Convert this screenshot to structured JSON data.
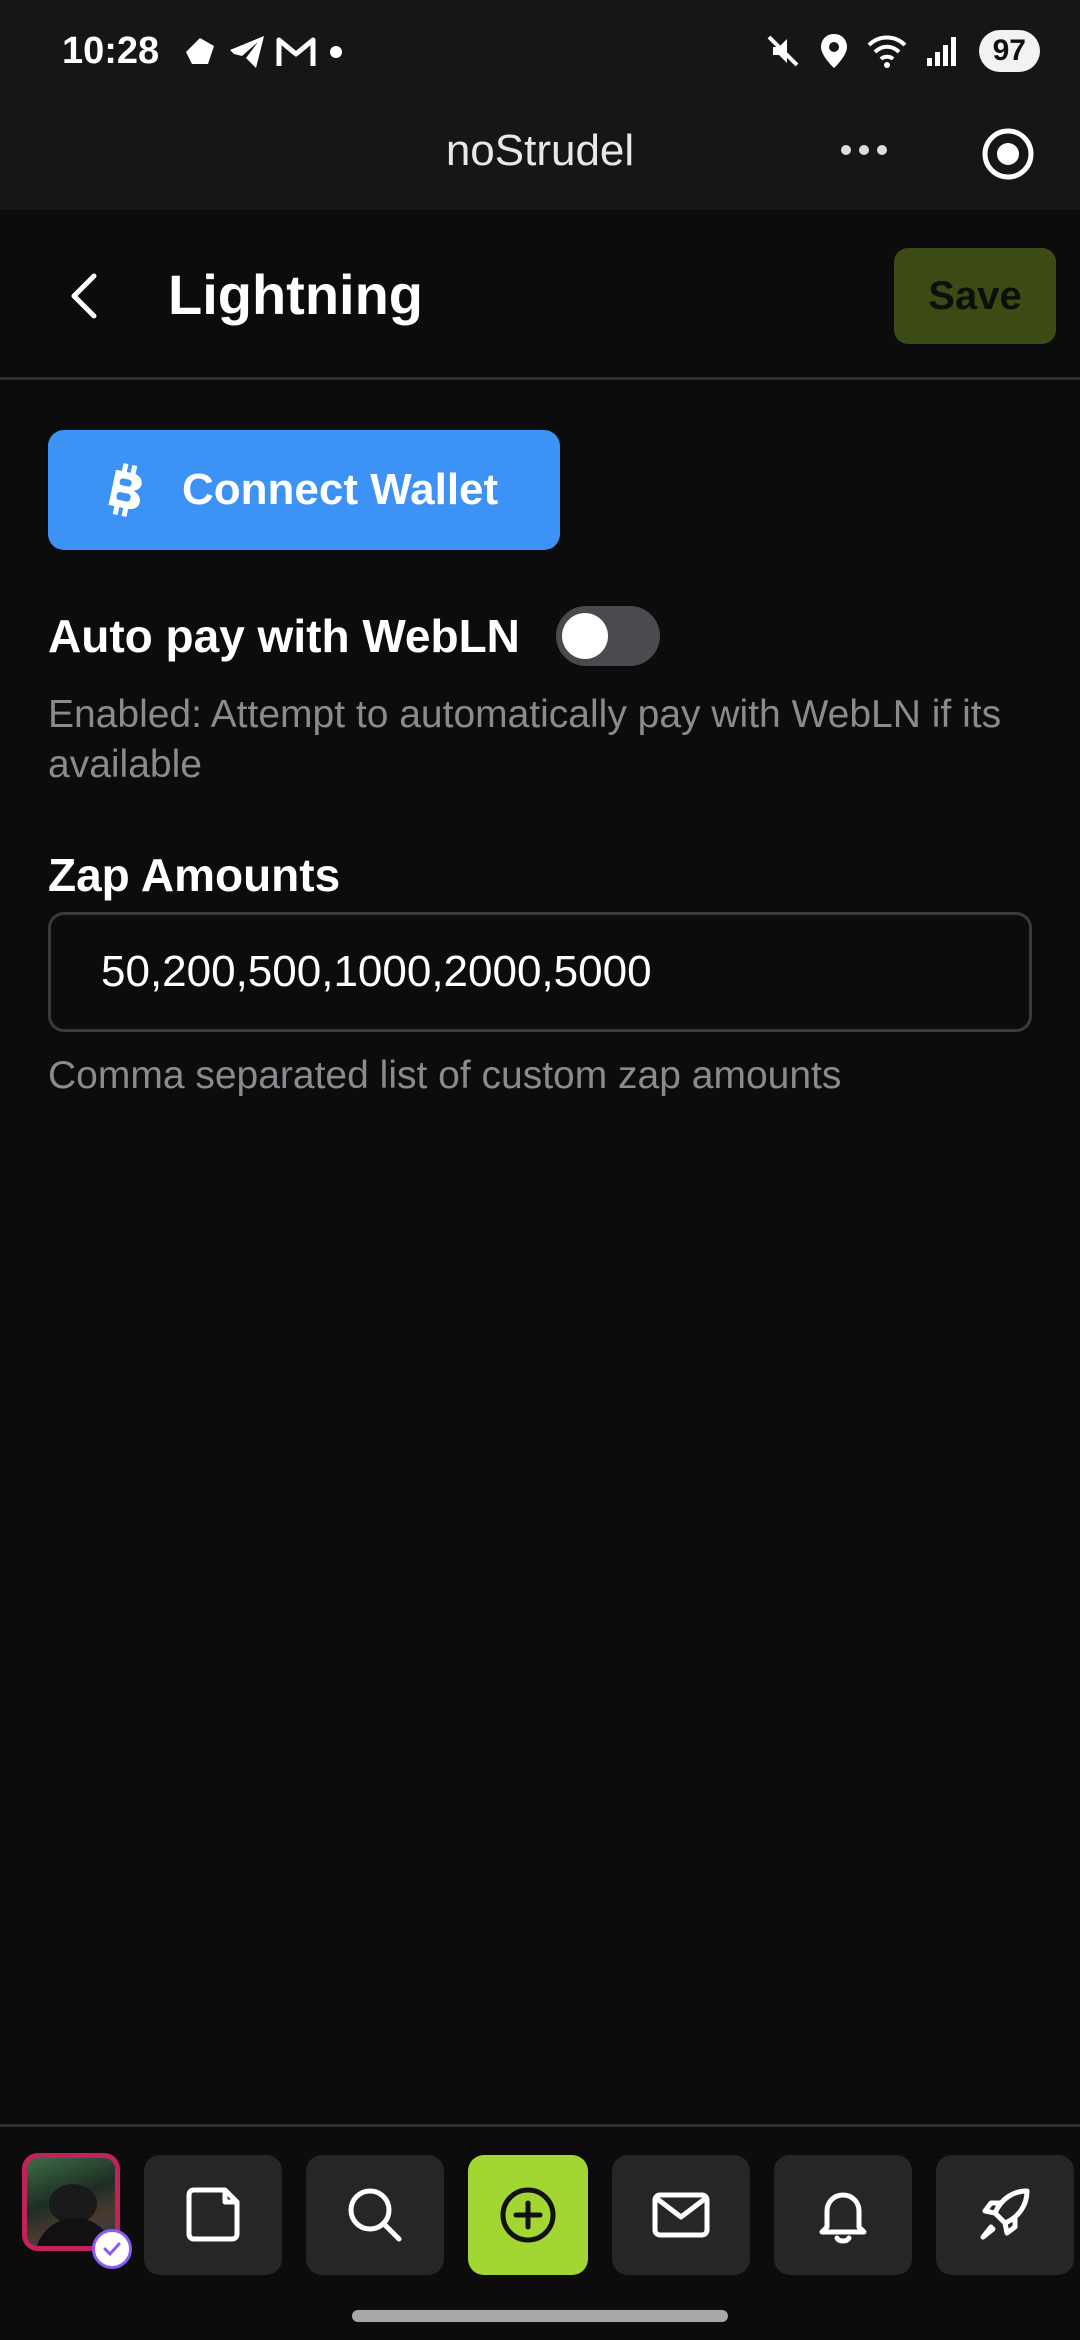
{
  "status_bar": {
    "time": "10:28",
    "battery": "97",
    "left_icons": [
      "signal-app-icon",
      "telegram-icon",
      "gmail-icon",
      "dot-icon"
    ],
    "right_icons": [
      "mute-icon",
      "location-icon",
      "wifi-icon",
      "cell-signal-icon"
    ]
  },
  "browser": {
    "title": "noStrudel"
  },
  "header": {
    "title": "Lightning",
    "save_label": "Save"
  },
  "wallet": {
    "connect_label": "Connect Wallet"
  },
  "autopay": {
    "label": "Auto pay with WebLN",
    "enabled": false,
    "help": "Enabled: Attempt to automatically pay with WebLN if its available"
  },
  "zap": {
    "label": "Zap Amounts",
    "value": "50,200,500,1000,2000,5000",
    "help": "Comma separated list of custom zap amounts"
  },
  "nav": {
    "items": [
      "avatar",
      "notes-icon",
      "search-icon",
      "post-icon",
      "messages-icon",
      "notifications-icon",
      "launch-icon"
    ]
  },
  "colors": {
    "accent_blue": "#3d93f5",
    "save_bg": "#3c4a16",
    "post_green": "#a2d733",
    "avatar_border": "#c2225a"
  }
}
